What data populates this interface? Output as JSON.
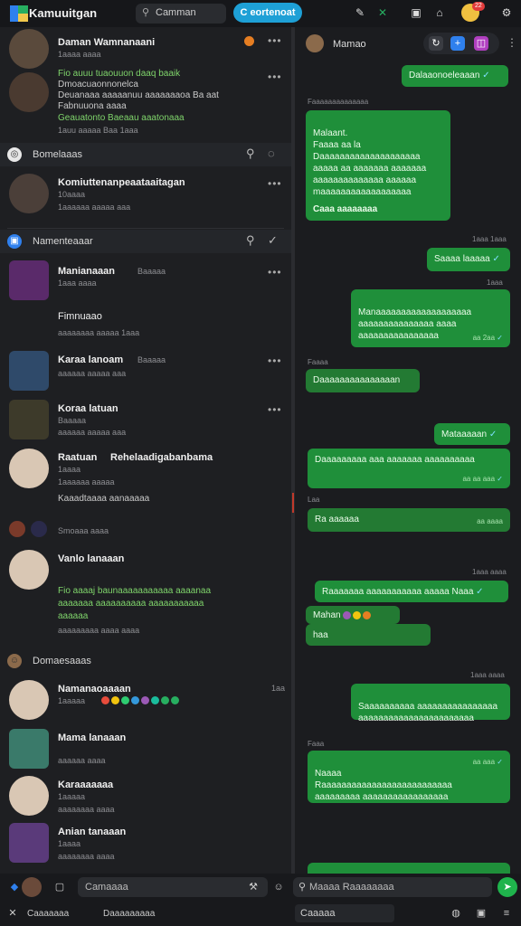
{
  "app": {
    "title": "Kamuuitgan",
    "search_label": "Camman",
    "active_tab": "C eortenoat",
    "badge": "22"
  },
  "sidebar": {
    "items_top": [
      {
        "name": "Daman Wamnanaani",
        "time": "1aaaa aaaa"
      },
      {
        "line1": "Fio auuu tuaouuon daaq baaik",
        "line2": "Dmoacuaonnonelca",
        "line3": "Deuanaaa aaaaanuu aaaaaaaoa Ba aat",
        "line4": "Fabnuuona aaaa",
        "line5": "Geauatonto Baeaau aaatonaaa",
        "meta": "1auu aaaaa Baa 1aaa"
      }
    ],
    "sections": [
      {
        "label": "Bomelaaas",
        "items": [
          {
            "name": "Komiuttenanpeaataaitagan",
            "meta1": "10aaaa",
            "meta2": "1aaaaaa aaaaa aaa"
          }
        ]
      },
      {
        "label": "Namenteaaar",
        "items": [
          {
            "name": "Manianaaan",
            "sub": "Baaaaa",
            "meta": "1aaa aaaa",
            "extra": "Fimnuaao",
            "meta2": "aaaaaaaa aaaaa 1aaa"
          },
          {
            "name": "Karaa lanoam",
            "sub": "Baaaaa",
            "meta": "aaaaaa aaaaa aaa"
          },
          {
            "name": "Koraa latuan",
            "meta": "Baaaaa",
            "meta2": "aaaaaa aaaaa aaa"
          },
          {
            "name": "Raatuan",
            "sub": "Rehelaadigabanbama",
            "meta": "1aaaa",
            "meta2": "1aaaaaa aaaaa"
          },
          {
            "name": "Kaaadtaaaa aanaaaaa",
            "meta": "Smoaaa aaaa"
          },
          {
            "name": "Vanlo lanaaan",
            "line1": "Fio aaaaj baunaaaaaaaaaaa aaaanaa",
            "line2": "aaaaaaa aaaaaaaaaa aaaaaaaaaaa",
            "line3": "aaaaaa",
            "meta": "aaaaaaaaa aaaa aaaa"
          }
        ]
      },
      {
        "label": "Domaesaaas",
        "items": [
          {
            "name": "Namanaoaaaan",
            "meta": "1aaaaa",
            "time": "1aa"
          },
          {
            "name": "Mama lanaaan",
            "meta": "aaaaaa aaaa"
          },
          {
            "name": "Karaaaaaaa",
            "meta": "1aaaaa",
            "meta2": "aaaaaaaa aaaa"
          },
          {
            "name": "Anian tanaaan",
            "meta": "1aaaa",
            "meta2": "aaaaaaaa aaaa"
          }
        ]
      }
    ]
  },
  "chat": {
    "header_name": "Mamao",
    "messages": [
      {
        "text": "Dalaaonoeleaaan",
        "dir": "out"
      },
      {
        "ts": "Faaaaaaaaaaaaaa"
      },
      {
        "text": "Malaant.\nFaaaa  aa  la\nDaaaaaaaaaaaaaaaaaaaa\naaaaa aa aaaaaaa aaaaaaa\naaaaaaaaaaaaaa aaaaaa\nmaaaaaaaaaaaaaaaaaa",
        "footer": "Caaa aaaaaaaa",
        "dir": "out"
      },
      {
        "ts": "1aaa 1aaa"
      },
      {
        "text": "Saaaa laaaaa",
        "dir": "out"
      },
      {
        "ts": "1aaa"
      },
      {
        "text": "Manaaaaaaaaaaaaaaaaaaa\naaaaaaaaaaaaaaa aaaa\naaaaaaaaaaaaaaaa",
        "time": "aa 2aa",
        "dir": "out"
      },
      {
        "ts": "Faaaa"
      },
      {
        "text": "Daaaaaaaaaaaaaaan",
        "dir": "in"
      },
      {
        "text": "Mataaaaan",
        "dir": "out"
      },
      {
        "text": "Daaaaaaaaa aaa aaaaaaa aaaaaaaaaa",
        "time": "aa aa aaa",
        "dir": "out"
      },
      {
        "ts": "Laa"
      },
      {
        "text": "Ra aaaaaa",
        "time": "aa aaaa",
        "dir": "in"
      },
      {
        "ts": "1aaa aaaa"
      },
      {
        "text": "Raaaaaaa aaaaaaaaaaa aaaaa Naaa",
        "dir": "out"
      },
      {
        "text": "Mahan",
        "dir": "in"
      },
      {
        "text": "haa",
        "dir": "in"
      },
      {
        "ts": "1aaa aaaa"
      },
      {
        "text": "Saaaaaaaaaa aaaaaaaaaaaaaaaa\naaaaaaaaaaaaaaaaaaaaaaa",
        "dir": "out"
      },
      {
        "ts": "Faaa"
      },
      {
        "text": "Naaaa\nRaaaaaaaaaaaaaaaaaaaaaaaaaa\naaaaaaaaa aaaaaaaaaaaaaaaaa",
        "time": "aa aaa",
        "dir": "out"
      }
    ]
  },
  "bottombar": {
    "left_compose": "Camaaaa",
    "right_compose": "Maaaa Raaaaaaaa",
    "label1": "Caaaaaaa",
    "label2": "Daaaaaaaaa",
    "label3": "Caaaaa"
  }
}
